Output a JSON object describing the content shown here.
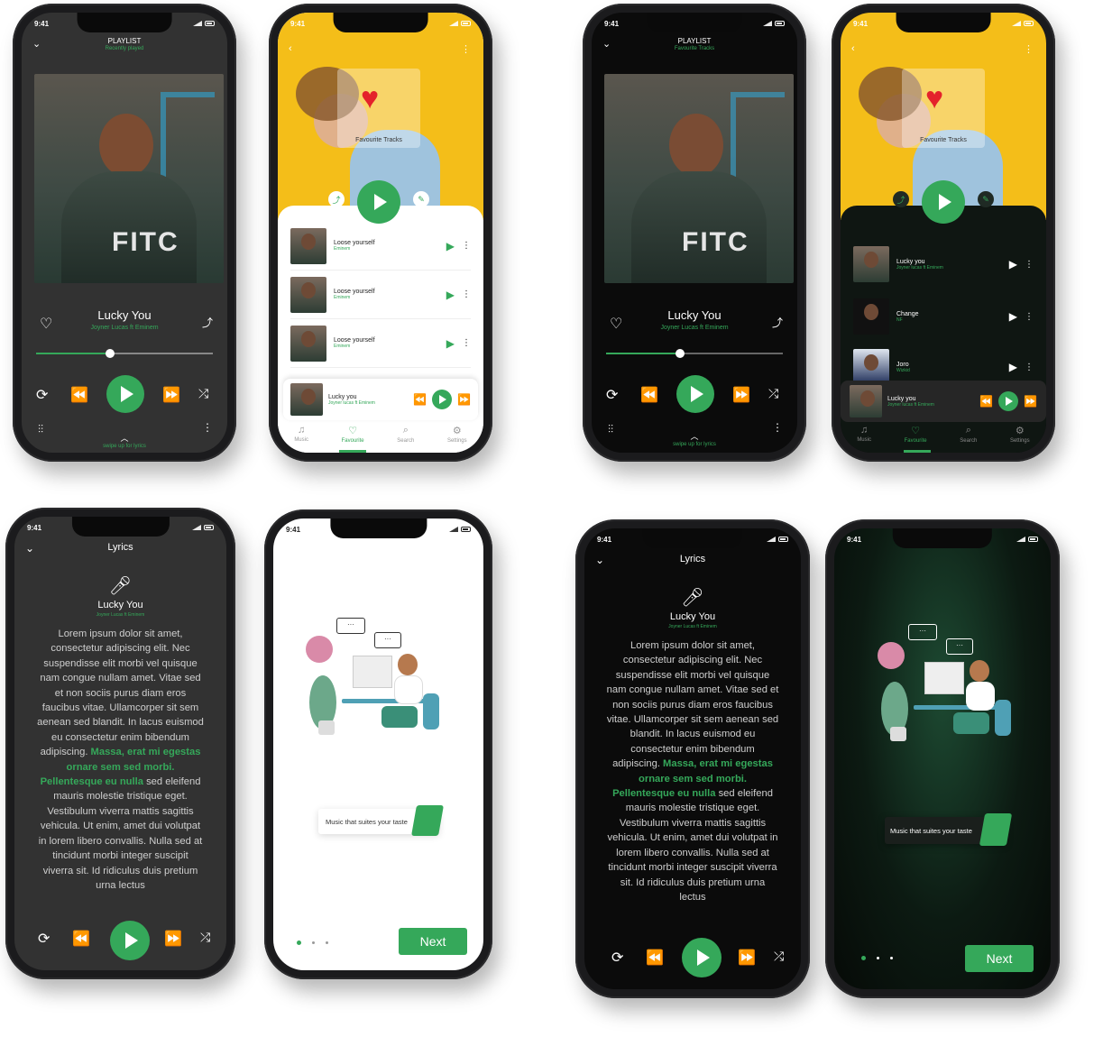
{
  "status_time": "9:41",
  "colors": {
    "accent": "#35a85a",
    "dark_bg": "#323232",
    "black_bg": "#0b0b0b",
    "yellow_bg": "#f4be19",
    "heart": "#e4222b"
  },
  "player_dark": {
    "header": "PLAYLIST",
    "subheader": "Recently played",
    "song": "Lucky You",
    "artist": "Joyner Lucas ft Eminem",
    "progress": 0.42,
    "hint": "swipe up for lyrics"
  },
  "player_black": {
    "header": "PLAYLIST",
    "subheader": "Favourite Tracks",
    "song": "Lucky You",
    "artist": "Joyner Lucas ft Eminem",
    "progress": 0.42,
    "hint": "swipe up for lyrics"
  },
  "fav_light": {
    "card_label": "Favourite Tracks",
    "tracks": [
      {
        "title": "Loose yourself",
        "artist": "Eminem"
      },
      {
        "title": "Loose yourself",
        "artist": "Eminem"
      },
      {
        "title": "Loose yourself",
        "artist": "Eminem"
      }
    ],
    "now_playing": {
      "title": "Lucky you",
      "artist": "Joyner lucas ft Eminem"
    },
    "tabs": [
      "Music",
      "Favourite",
      "Search",
      "Settings"
    ]
  },
  "fav_black": {
    "card_label": "Favourite Tracks",
    "tracks": [
      {
        "title": "Lucky you",
        "artist": "Joyner lucas ft Eminem"
      },
      {
        "title": "Change",
        "artist": "NF"
      },
      {
        "title": "Joro",
        "artist": "Wizkid"
      }
    ],
    "now_playing": {
      "title": "Lucky you",
      "artist": "Joyner lucas ft Eminem"
    },
    "tabs": [
      "Music",
      "Favourite",
      "Search",
      "Settings"
    ]
  },
  "lyrics": {
    "title": "Lyrics",
    "song": "Lucky You",
    "artist": "Joyner Lucas ft Eminem",
    "text_before": "Lorem ipsum dolor sit amet, consectetur adipiscing elit. Nec suspendisse elit morbi vel quisque nam congue nullam amet. Vitae sed et non sociis purus diam eros faucibus vitae. Ullamcorper sit sem aenean sed blandit. In lacus euismod eu consectetur enim bibendum adipiscing.",
    "highlight": "Massa, erat mi egestas ornare sem sed morbi. Pellentesque eu nulla",
    "text_after": "sed eleifend mauris molestie tristique eget. Vestibulum viverra mattis sagittis vehicula. Ut enim, amet dui volutpat in lorem libero convallis. Nulla sed at tincidunt morbi integer suscipit viverra sit. Id ridiculus duis pretium urna lectus"
  },
  "onboarding": {
    "caption": "Music that suites your taste",
    "next": "Next",
    "page_index": 0,
    "page_count": 3
  }
}
